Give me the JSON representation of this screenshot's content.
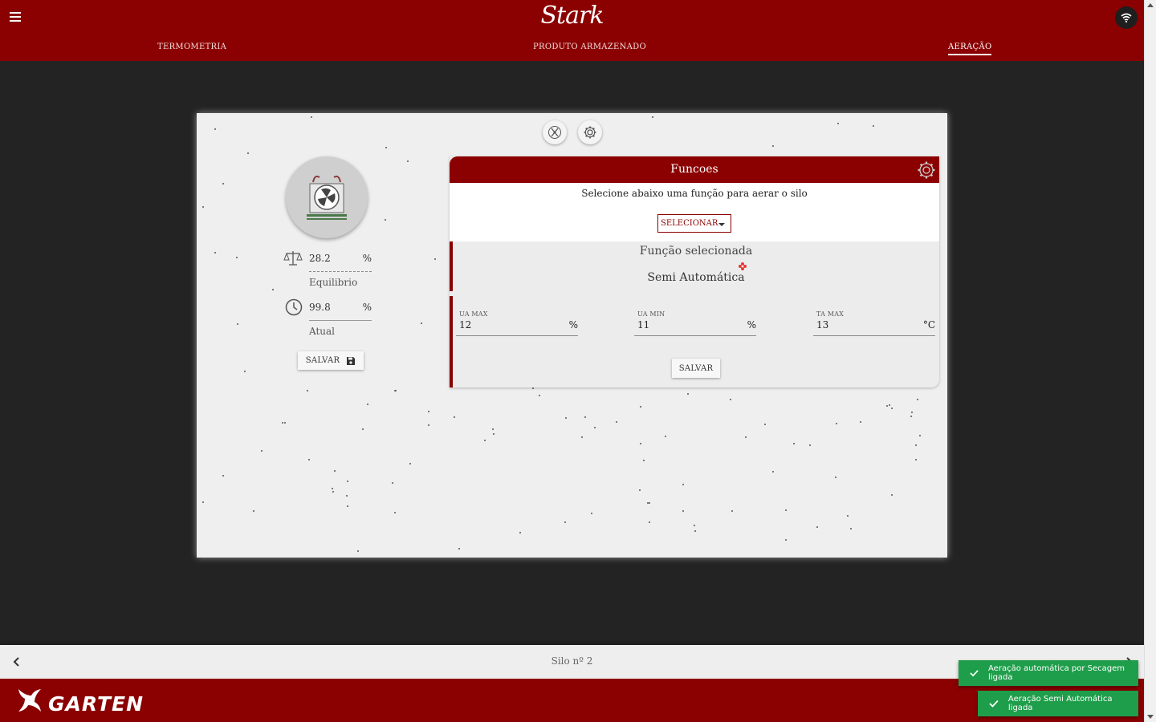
{
  "app": {
    "title": "Stark",
    "brand": "GARTEN"
  },
  "tabs": [
    {
      "label": "TERMOMETRIA"
    },
    {
      "label": "PRODUTO ARMAZENADO"
    },
    {
      "label": "AERAÇÃO"
    }
  ],
  "left_panel": {
    "equilibrio": {
      "value": "28.2",
      "unit": "%",
      "label": "Equilibrio"
    },
    "atual": {
      "value": "99.8",
      "unit": "%",
      "label": "Atual"
    },
    "save_label": "SALVAR"
  },
  "functions_panel": {
    "title": "Funcoes",
    "instruction": "Selecione abaixo uma função para aerar o silo",
    "select_label": "SELECIONAR",
    "selected_title": "Função selecionada",
    "selected_value": "Semi Automática",
    "fields": [
      {
        "label": "UA MAX",
        "value": "12",
        "unit": "%"
      },
      {
        "label": "UA MIN",
        "value": "11",
        "unit": "%"
      },
      {
        "label": "TA MAX",
        "value": "13",
        "unit": "°C"
      }
    ],
    "save_label": "SALVAR"
  },
  "bottom_nav": {
    "silo_label": "Silo nº 2"
  },
  "toasts": [
    {
      "text": "Aeração automática por Secagem ligada"
    },
    {
      "text": "Aeração Semi Automática ligada"
    }
  ],
  "colors": {
    "primary": "#8b0000",
    "background": "#232323",
    "card": "#efefef",
    "toast": "#1e9e4a"
  },
  "icons": [
    "menu-icon",
    "wifi-icon",
    "fan-icon",
    "settings-icon",
    "scale-icon",
    "clock-icon",
    "save-icon",
    "chevron-left-icon",
    "chevron-right-icon",
    "check-icon"
  ]
}
